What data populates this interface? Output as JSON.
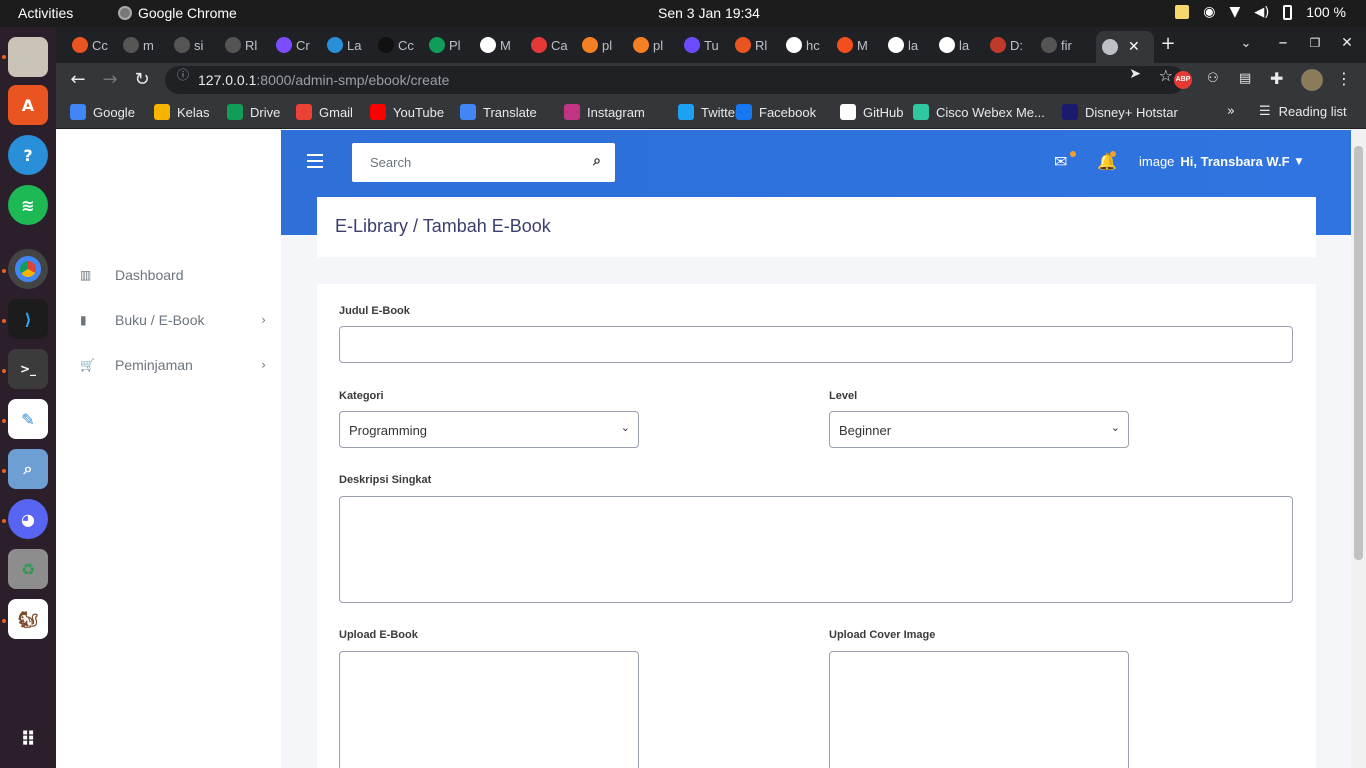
{
  "os": {
    "activities": "Activities",
    "app_name": "Google Chrome",
    "clock": "Sen  3 Jan  19:34",
    "battery": "100 %"
  },
  "browser": {
    "active_tab_icon": "globe-icon",
    "url_host": "127.0.0.1",
    "url_path": ":8000/admin-smp/ebook/create",
    "tabs": [
      "Cc",
      "m",
      "si",
      "Rl",
      "Cr",
      "La",
      "Cc",
      "Pl",
      "M",
      "Ca",
      "pl",
      "pl",
      "Tu",
      "Rl",
      "hc",
      "M",
      "la",
      "la",
      "D:",
      "fir"
    ]
  },
  "bookmarks": [
    {
      "label": "Google",
      "color": "#4285f4"
    },
    {
      "label": "Kelas",
      "color": "#f4b400"
    },
    {
      "label": "Drive",
      "color": "#0f9d58"
    },
    {
      "label": "Gmail",
      "color": "#ea4335"
    },
    {
      "label": "YouTube",
      "color": "#ff0000"
    },
    {
      "label": "Translate",
      "color": "#4285f4"
    },
    {
      "label": "Instagram",
      "color": "#c13584"
    },
    {
      "label": "Twitter",
      "color": "#1da1f2"
    },
    {
      "label": "Facebook",
      "color": "#1877f2"
    },
    {
      "label": "GitHub",
      "color": "#ffffff"
    },
    {
      "label": "Cisco Webex Me...",
      "color": "#2fc8a0"
    },
    {
      "label": "Disney+ Hotstar",
      "color": "#1a1a6e"
    }
  ],
  "reading_list": "Reading list",
  "sidebar": {
    "items": [
      {
        "label": "Dashboard",
        "icon": "table-icon",
        "has_children": false
      },
      {
        "label": "Buku / E-Book",
        "icon": "book-icon",
        "has_children": true
      },
      {
        "label": "Peminjaman",
        "icon": "cart-icon",
        "has_children": true
      }
    ]
  },
  "header": {
    "search_placeholder": "Search",
    "user_image_alt": "image",
    "user_greeting": "Hi, Transbara W.F"
  },
  "breadcrumb": "E-Library / Tambah E-Book",
  "form": {
    "title_label": "Judul E-Book",
    "title_value": "",
    "category_label": "Kategori",
    "category_value": "Programming",
    "level_label": "Level",
    "level_value": "Beginner",
    "description_label": "Deskripsi Singkat",
    "description_value": "",
    "upload_ebook_label": "Upload E-Book",
    "upload_cover_label": "Upload Cover Image"
  }
}
